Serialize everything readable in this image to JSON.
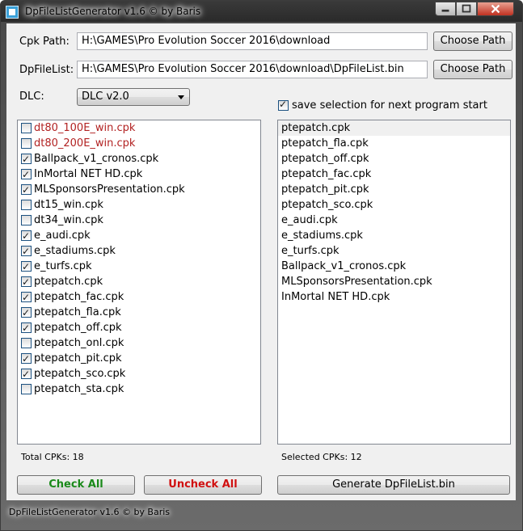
{
  "window": {
    "title": "DpFileListGenerator v1.6 © by Baris",
    "status_text": "DpFileListGenerator v1.6 © by Baris"
  },
  "cpk_path": {
    "label": "Cpk Path:",
    "value": "H:\\GAMES\\Pro Evolution Soccer 2016\\download",
    "button": "Choose Path"
  },
  "dpfilelist": {
    "label": "DpFileList:",
    "value": "H:\\GAMES\\Pro Evolution Soccer 2016\\download\\DpFileList.bin",
    "button": "Choose Path"
  },
  "dlc": {
    "label": "DLC:",
    "selected": "DLC v2.0"
  },
  "save_selection": {
    "label": "save selection for next program start",
    "checked": true
  },
  "cpk_list": {
    "items": [
      {
        "name": "dt80_100E_win.cpk",
        "checked": false,
        "color": "#b22222"
      },
      {
        "name": "dt80_200E_win.cpk",
        "checked": false,
        "color": "#b22222"
      },
      {
        "name": "Ballpack_v1_cronos.cpk",
        "checked": true,
        "color": "#000000"
      },
      {
        "name": "InMortal NET HD.cpk",
        "checked": true,
        "color": "#000000"
      },
      {
        "name": "MLSponsorsPresentation.cpk",
        "checked": true,
        "color": "#000000"
      },
      {
        "name": "dt15_win.cpk",
        "checked": false,
        "color": "#000000"
      },
      {
        "name": "dt34_win.cpk",
        "checked": false,
        "color": "#000000"
      },
      {
        "name": "e_audi.cpk",
        "checked": true,
        "color": "#000000"
      },
      {
        "name": "e_stadiums.cpk",
        "checked": true,
        "color": "#000000"
      },
      {
        "name": "e_turfs.cpk",
        "checked": true,
        "color": "#000000"
      },
      {
        "name": "ptepatch.cpk",
        "checked": true,
        "color": "#000000"
      },
      {
        "name": "ptepatch_fac.cpk",
        "checked": true,
        "color": "#000000"
      },
      {
        "name": "ptepatch_fla.cpk",
        "checked": true,
        "color": "#000000"
      },
      {
        "name": "ptepatch_off.cpk",
        "checked": true,
        "color": "#000000"
      },
      {
        "name": "ptepatch_onl.cpk",
        "checked": false,
        "color": "#000000"
      },
      {
        "name": "ptepatch_pit.cpk",
        "checked": true,
        "color": "#000000"
      },
      {
        "name": "ptepatch_sco.cpk",
        "checked": true,
        "color": "#000000"
      },
      {
        "name": "ptepatch_sta.cpk",
        "checked": false,
        "color": "#000000"
      }
    ],
    "total_label": "Total CPKs: 18"
  },
  "selected_list": {
    "items": [
      "ptepatch.cpk",
      "ptepatch_fla.cpk",
      "ptepatch_off.cpk",
      "ptepatch_fac.cpk",
      "ptepatch_pit.cpk",
      "ptepatch_sco.cpk",
      "e_audi.cpk",
      "e_stadiums.cpk",
      "e_turfs.cpk",
      "Ballpack_v1_cronos.cpk",
      "MLSponsorsPresentation.cpk",
      "InMortal NET HD.cpk"
    ],
    "selected_label": "Selected CPKs: 12"
  },
  "buttons": {
    "check_all": "Check All",
    "check_all_color": "#1a8a1a",
    "uncheck_all": "Uncheck All",
    "uncheck_all_color": "#d01010",
    "generate": "Generate DpFileList.bin"
  }
}
